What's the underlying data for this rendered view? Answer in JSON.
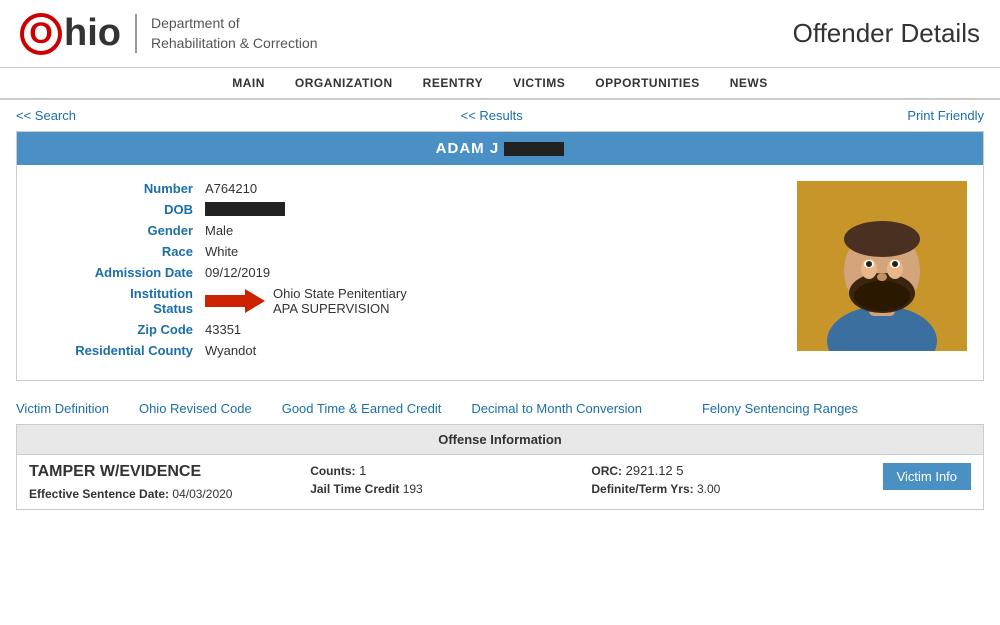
{
  "header": {
    "logo_o": "O",
    "logo_hio": "hio",
    "dept_line1": "Department of",
    "dept_line2": "Rehabilitation & Correction",
    "page_title": "Offender Details"
  },
  "nav": {
    "items": [
      {
        "label": "MAIN",
        "url": "#"
      },
      {
        "label": "ORGANIZATION",
        "url": "#"
      },
      {
        "label": "REENTRY",
        "url": "#"
      },
      {
        "label": "VICTIMS",
        "url": "#"
      },
      {
        "label": "OPPORTUNITIES",
        "url": "#"
      },
      {
        "label": "NEWS",
        "url": "#"
      }
    ]
  },
  "breadcrumb": {
    "search_label": "<< Search",
    "results_label": "<< Results",
    "print_label": "Print Friendly"
  },
  "offender": {
    "name": "ADAM J",
    "name_redacted": true,
    "number_label": "Number",
    "number_value": "A764210",
    "dob_label": "DOB",
    "dob_redacted": true,
    "gender_label": "Gender",
    "gender_value": "Male",
    "race_label": "Race",
    "race_value": "White",
    "admission_label": "Admission Date",
    "admission_value": "09/12/2019",
    "institution_label": "Institution",
    "institution_value": "Ohio State Penitentiary",
    "status_label": "Status",
    "status_value": "APA SUPERVISION",
    "zip_label": "Zip Code",
    "zip_value": "43351",
    "county_label": "Residential County",
    "county_value": "Wyandot"
  },
  "links": [
    {
      "label": "Victim Definition",
      "url": "#"
    },
    {
      "label": "Ohio Revised Code",
      "url": "#"
    },
    {
      "label": "Good Time & Earned Credit",
      "url": "#"
    },
    {
      "label": "Decimal to Month Conversion",
      "url": "#"
    },
    {
      "label": "Felony Sentencing Ranges",
      "url": "#"
    }
  ],
  "offense": {
    "section_header": "Offense Information",
    "title": "TAMPER W/EVIDENCE",
    "counts_label": "Counts:",
    "counts_value": "1",
    "orc_label": "ORC:",
    "orc_value": "2921.12 5",
    "victim_btn_label": "Victim Info",
    "effective_sentence_label": "Effective Sentence Date:",
    "effective_sentence_value": "04/03/2020",
    "jail_time_label": "Jail Time Credit",
    "jail_time_value": "193",
    "definite_term_label": "Definite/Term Yrs:",
    "definite_term_value": "3.00"
  }
}
